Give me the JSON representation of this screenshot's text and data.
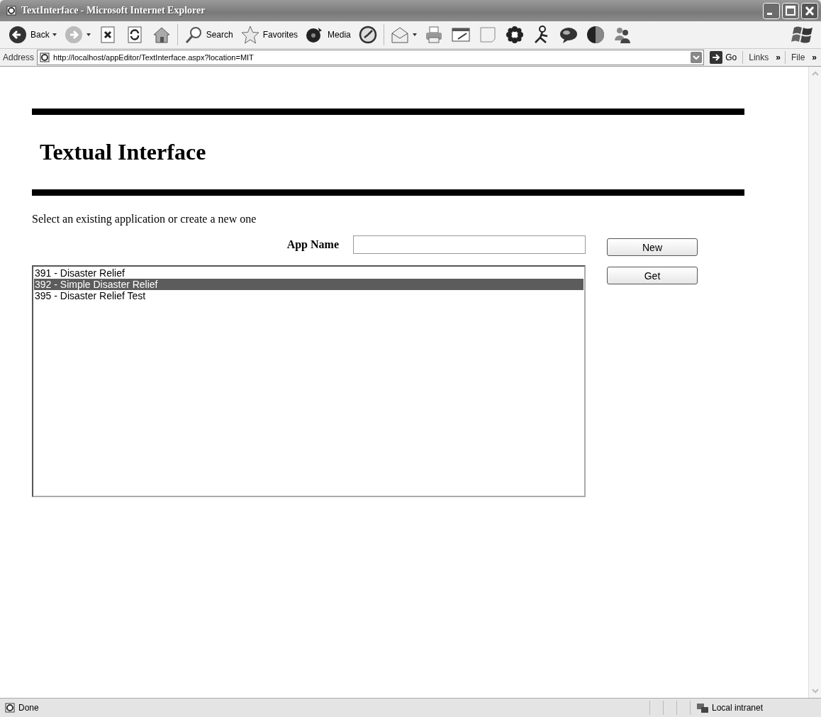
{
  "window": {
    "title": "TextInterface - Microsoft Internet Explorer"
  },
  "toolbar": [
    {
      "kind": "labeled",
      "label": "Back",
      "dropdown": true
    },
    {
      "kind": "icon",
      "dropdown": true
    },
    {
      "kind": "icon",
      "dropdown": false
    },
    {
      "kind": "icon",
      "dropdown": false
    },
    {
      "kind": "icon",
      "dropdown": false
    },
    {
      "kind": "labeled",
      "label": "Search",
      "dropdown": false
    },
    {
      "kind": "labeled",
      "label": "Favorites",
      "dropdown": false
    },
    {
      "kind": "labeled",
      "label": "Media",
      "dropdown": false
    },
    {
      "kind": "icon",
      "dropdown": false
    },
    {
      "kind": "icon",
      "dropdown": true
    },
    {
      "kind": "icon",
      "dropdown": false
    },
    {
      "kind": "icon",
      "dropdown": false
    },
    {
      "kind": "icon",
      "dropdown": false
    },
    {
      "kind": "icon",
      "dropdown": false
    },
    {
      "kind": "icon",
      "dropdown": false
    },
    {
      "kind": "icon",
      "dropdown": false
    },
    {
      "kind": "icon",
      "dropdown": false
    },
    {
      "kind": "icon",
      "dropdown": false
    }
  ],
  "address_bar": {
    "label": "Address",
    "url": "http://localhost/appEditor/TextInterface.aspx?location=MIT",
    "go": "Go",
    "links": "Links",
    "links_chevron": "»",
    "menu": "File",
    "menu_chevron": "»"
  },
  "page": {
    "heading": "Textual Interface",
    "instructions": "Select an existing application or create a new one",
    "app_name_label": "App Name",
    "new_button": "New",
    "get_button": "Get",
    "applications": [
      {
        "label": "391 - Disaster Relief",
        "selected": false
      },
      {
        "label": "392 - Simple Disaster Relief",
        "selected": true
      },
      {
        "label": "395 - Disaster Relief Test",
        "selected": false
      }
    ]
  },
  "status_bar": {
    "status": "Done",
    "zone": "Local intranet"
  }
}
